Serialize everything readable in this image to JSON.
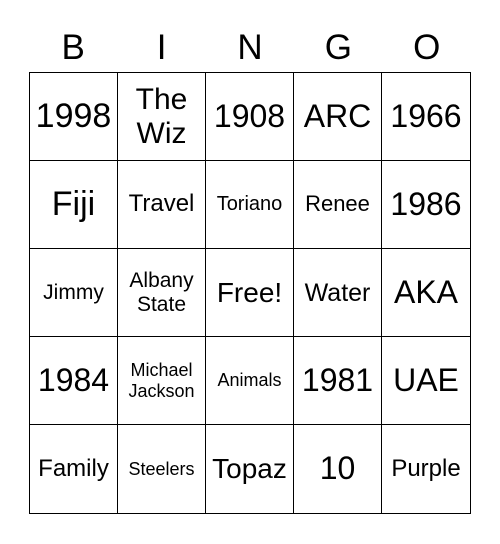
{
  "header": [
    "B",
    "I",
    "N",
    "G",
    "O"
  ],
  "cells": [
    [
      "1998",
      "The Wiz",
      "1908",
      "ARC",
      "1966"
    ],
    [
      "Fiji",
      "Travel",
      "Toriano",
      "Renee",
      "1986"
    ],
    [
      "Jimmy",
      "Albany State",
      "Free!",
      "Water",
      "AKA"
    ],
    [
      "1984",
      "Michael Jackson",
      "Animals",
      "1981",
      "UAE"
    ],
    [
      "Family",
      "Steelers",
      "Topaz",
      "10",
      "Purple"
    ]
  ]
}
